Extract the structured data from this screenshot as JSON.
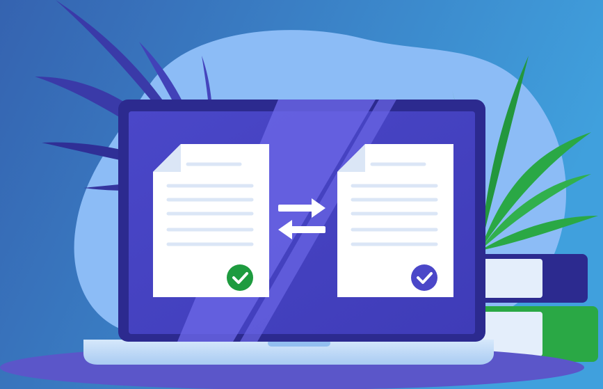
{
  "scene": {
    "description_role": "illustration",
    "colors": {
      "background_start": "#3563b0",
      "background_end": "#3f9ad8",
      "blob": "#8cbcf6",
      "laptop_frame": "#2c2a8f",
      "laptop_screen": "#4b47c8",
      "laptop_base": "#b9d7f7",
      "document": "#ffffff",
      "document_lines": "#dbe6f6",
      "check_green": "#1e9b3f",
      "check_purple": "#4b47c8",
      "leaf_purple": "#3a3aa8",
      "leaf_green": "#2aa845",
      "book_navy": "#2c2a8f",
      "book_green": "#2aa845",
      "shadow": "#5b56c9"
    },
    "icons": {
      "left_document": "document-icon",
      "right_document": "document-icon",
      "swap": "swap-arrows-icon",
      "left_check": "check-circle-icon",
      "right_check": "check-circle-icon"
    }
  }
}
